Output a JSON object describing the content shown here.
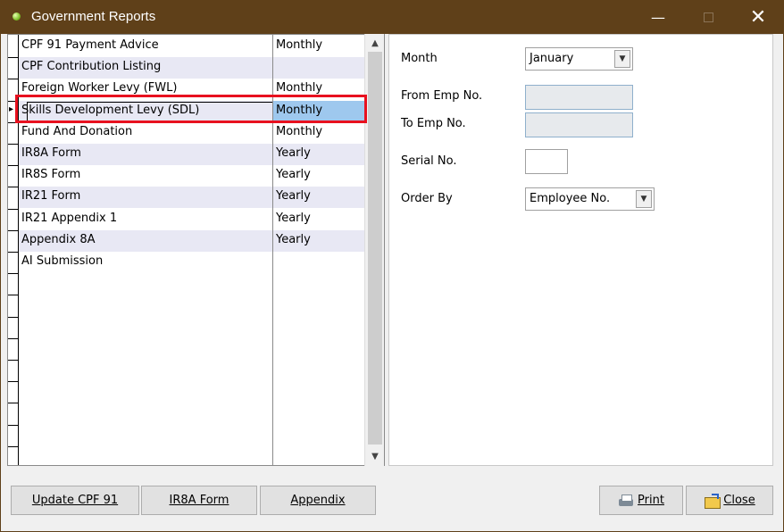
{
  "window": {
    "title": "Government Reports",
    "controls": {
      "minimize": "—",
      "maximize": "☐",
      "close": "✕"
    }
  },
  "report_list": {
    "rows": [
      {
        "name": "CPF 91 Payment Advice",
        "frequency": "Monthly"
      },
      {
        "name": "CPF Contribution Listing",
        "frequency": ""
      },
      {
        "name": "Foreign Worker Levy (FWL)",
        "frequency": "Monthly"
      },
      {
        "name": "Skills Development Levy (SDL)",
        "frequency": "Monthly",
        "selected": true
      },
      {
        "name": "Fund And Donation",
        "frequency": "Monthly"
      },
      {
        "name": "IR8A Form",
        "frequency": "Yearly"
      },
      {
        "name": "IR8S Form",
        "frequency": "Yearly"
      },
      {
        "name": "IR21 Form",
        "frequency": "Yearly"
      },
      {
        "name": "IR21 Appendix 1",
        "frequency": "Yearly"
      },
      {
        "name": "Appendix 8A",
        "frequency": "Yearly"
      },
      {
        "name": "AI Submission",
        "frequency": ""
      }
    ],
    "row_marker": "▸"
  },
  "options": {
    "month_label": "Month",
    "month_value": "January",
    "from_emp_label": "From Emp No.",
    "from_emp_value": "",
    "to_emp_label": "To Emp No.",
    "to_emp_value": "",
    "serial_label": "Serial No.",
    "serial_value": "",
    "order_by_label": "Order By",
    "order_by_value": "Employee No."
  },
  "buttons": {
    "update_cpf": "Update CPF 91",
    "ir8a": "IR8A Form",
    "appendix": "Appendix",
    "print": "Print",
    "close": "Close"
  }
}
